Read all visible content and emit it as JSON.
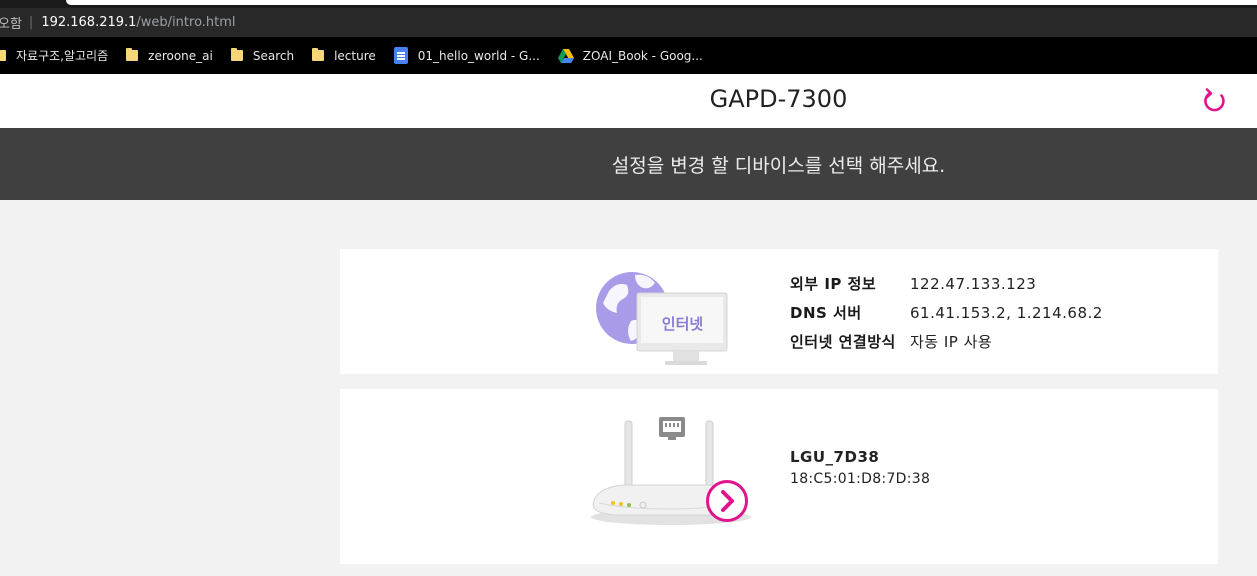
{
  "browser": {
    "security_label": "오함",
    "url_host": "192.168.219.1",
    "url_path": "/web/intro.html",
    "bookmarks": [
      {
        "label": "자료구조,알고리즘",
        "icon": "folder-icon"
      },
      {
        "label": "zeroone_ai",
        "icon": "folder-icon"
      },
      {
        "label": "Search",
        "icon": "folder-icon"
      },
      {
        "label": "lecture",
        "icon": "folder-icon"
      },
      {
        "label": "01_hello_world - G...",
        "icon": "google-docs-icon"
      },
      {
        "label": "ZOAI_Book - Goog...",
        "icon": "google-drive-icon"
      }
    ]
  },
  "header": {
    "title": "GAPD-7300",
    "refresh_icon": "refresh-icon"
  },
  "banner": {
    "text": "설정을 변경 할 디바이스를 선택 해주세요."
  },
  "internet": {
    "monitor_label": "인터넷",
    "rows": [
      {
        "label": "외부 IP 정보",
        "value": "122.47.133.123"
      },
      {
        "label": "DNS 서버",
        "value": "61.41.153.2, 1.214.68.2"
      },
      {
        "label": "인터넷 연결방식",
        "value": "자동 IP 사용"
      }
    ]
  },
  "device": {
    "name": "LGU_7D38",
    "mac": "18:C5:01:D8:7D:38",
    "arrow_icon": "chevron-right-icon"
  },
  "colors": {
    "accent": "#e0158c",
    "banner_bg": "#404040",
    "page_bg": "#f2f2f2",
    "globe": "#a99be8"
  }
}
